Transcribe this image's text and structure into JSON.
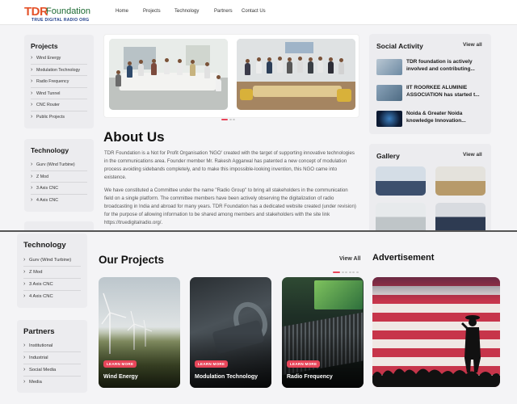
{
  "logo": {
    "tdr": "TDR",
    "foundation": "Foundation",
    "subtitle": "TRUE DIGITAL RADIO ORG"
  },
  "nav": {
    "home": "Home",
    "projects": "Projects",
    "technology": "Technology",
    "partners": "Partners",
    "contact": "Contact Us"
  },
  "sidebar_top": {
    "projects": {
      "title": "Projects",
      "items": [
        "Wind Energy",
        "Modulation Technology",
        "Radio Frequency",
        "Wind Tunnel",
        "CNC Router",
        "Public Projects"
      ]
    },
    "technology": {
      "title": "Technology",
      "items": [
        "Gurv (Wind Turbine)",
        "Z Mod",
        "3 Axis CNC",
        "4 Axis CNC"
      ]
    }
  },
  "about": {
    "title": "About Us",
    "p1": "TDR Foundation is a Not for Profit Organisation 'NGO' created with the target of supporting innovative technologies in the communications area. Founder member Mr. Rakesh Aggarwal has patented a new concept of modulation process avoiding sidebands completely, and to make this impossible-looking invention, this NGO came into existence.",
    "p2": "We have constituted a Committee under the name \"Radio Group\" to bring all stakeholders in the communication field on a single platform. The committee members have been actively observing the digitalization of radio broadcasting in India and abroad for many years. TDR Foundation has a dedicated website created (under revision) for the purpose of allowing information to be shared among members and stakeholders with the site link https://truedigitalradio.org/."
  },
  "social": {
    "title": "Social Activity",
    "view_all": "View all",
    "items": [
      "TDR foundation is actively involved and contributing...",
      "IIT ROORKEE ALUMINIE ASSOCIATION has started t...",
      "Noida & Greater Noida knowledge Innovation..."
    ]
  },
  "gallery": {
    "title": "Gallery",
    "view_all": "View all"
  },
  "sidebar_bottom": {
    "technology": {
      "title": "Technology",
      "items": [
        "Gurv (Wind Turbine)",
        "Z Mod",
        "3 Axis CNC",
        "4 Axis CNC"
      ]
    },
    "partners": {
      "title": "Partners",
      "items": [
        "Institutional",
        "Industrial",
        "Social Media",
        "Media"
      ]
    }
  },
  "our_projects": {
    "title": "Our Projects",
    "view_all": "View All",
    "badge": "LEARN MORE",
    "cards": [
      "Wind Energy",
      "Modulation Technology",
      "Radio Frequency"
    ]
  },
  "advertisement": {
    "title": "Advertisement"
  },
  "colors": {
    "accent": "#e8465a",
    "card_bg": "#ececef",
    "logo_orange": "#e4532a",
    "logo_green": "#1d6b33"
  }
}
